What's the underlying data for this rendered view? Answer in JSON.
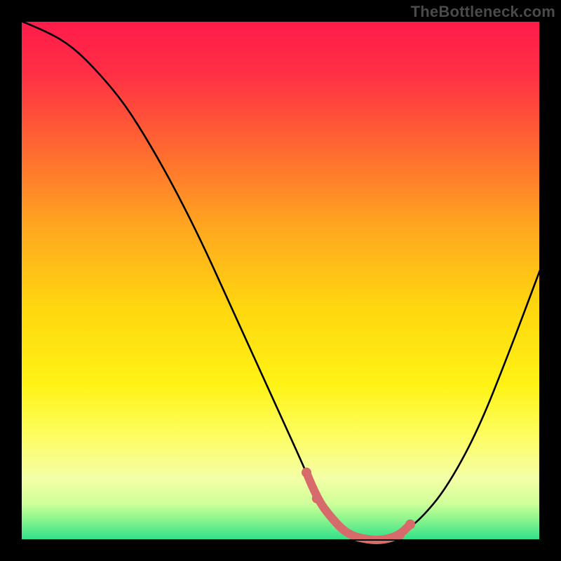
{
  "watermark": "TheBottleneck.com",
  "colors": {
    "frame": "#000000",
    "curve": "#000000",
    "marker": "#d76a6a",
    "gradient_stops": [
      {
        "offset": 0.0,
        "color": "#ff1b4b"
      },
      {
        "offset": 0.1,
        "color": "#ff2f45"
      },
      {
        "offset": 0.25,
        "color": "#ff6a30"
      },
      {
        "offset": 0.4,
        "color": "#ffa81f"
      },
      {
        "offset": 0.55,
        "color": "#ffd60f"
      },
      {
        "offset": 0.7,
        "color": "#fff314"
      },
      {
        "offset": 0.8,
        "color": "#fdfd62"
      },
      {
        "offset": 0.88,
        "color": "#f4ffa6"
      },
      {
        "offset": 0.93,
        "color": "#cfff9a"
      },
      {
        "offset": 0.96,
        "color": "#8cf58d"
      },
      {
        "offset": 1.0,
        "color": "#2fe08a"
      }
    ]
  },
  "chart_data": {
    "type": "line",
    "title": "",
    "xlabel": "",
    "ylabel": "",
    "xlim": [
      0,
      100
    ],
    "ylim": [
      0,
      100
    ],
    "series": [
      {
        "name": "bottleneck-curve",
        "x": [
          0,
          5,
          10,
          15,
          20,
          25,
          30,
          35,
          40,
          45,
          50,
          55,
          57,
          60,
          63,
          67,
          70,
          73,
          77,
          82,
          88,
          94,
          100
        ],
        "y": [
          100,
          98,
          95,
          90,
          84,
          76,
          67,
          57,
          46,
          35,
          24,
          13,
          8,
          4,
          1,
          0,
          0,
          1,
          4,
          10,
          21,
          36,
          52
        ]
      }
    ],
    "markers": {
      "name": "highlight-band",
      "x": [
        55,
        57,
        60,
        63,
        67,
        70,
        73,
        75
      ],
      "y": [
        13,
        8,
        4,
        1,
        0,
        0,
        1,
        3
      ]
    }
  }
}
